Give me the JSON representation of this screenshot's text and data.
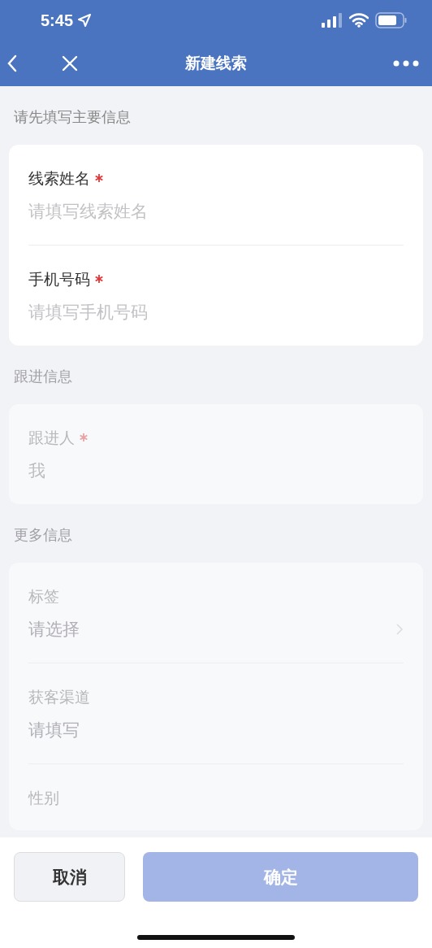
{
  "status_bar": {
    "time": "5:45"
  },
  "nav_bar": {
    "title": "新建线索"
  },
  "sections": [
    {
      "title": "请先填写主要信息",
      "dimmed": false,
      "fields": [
        {
          "kind": "input",
          "label": "线索姓名",
          "required": true,
          "placeholder": "请填写线索姓名"
        },
        {
          "kind": "input",
          "label": "手机号码",
          "required": true,
          "placeholder": "请填写手机号码"
        }
      ]
    },
    {
      "title": "跟进信息",
      "dimmed": true,
      "fields": [
        {
          "kind": "input",
          "label": "跟进人",
          "required": true,
          "value": "我"
        }
      ]
    },
    {
      "title": "更多信息",
      "dimmed": true,
      "fields": [
        {
          "kind": "select",
          "label": "标签",
          "required": false,
          "placeholder": "请选择"
        },
        {
          "kind": "input",
          "label": "获客渠道",
          "required": false,
          "placeholder": "请填写"
        },
        {
          "kind": "input",
          "label": "性别",
          "required": false
        }
      ]
    }
  ],
  "footer": {
    "cancel": {
      "label": "取消"
    },
    "confirm": {
      "label": "确定",
      "disabled": true
    }
  }
}
